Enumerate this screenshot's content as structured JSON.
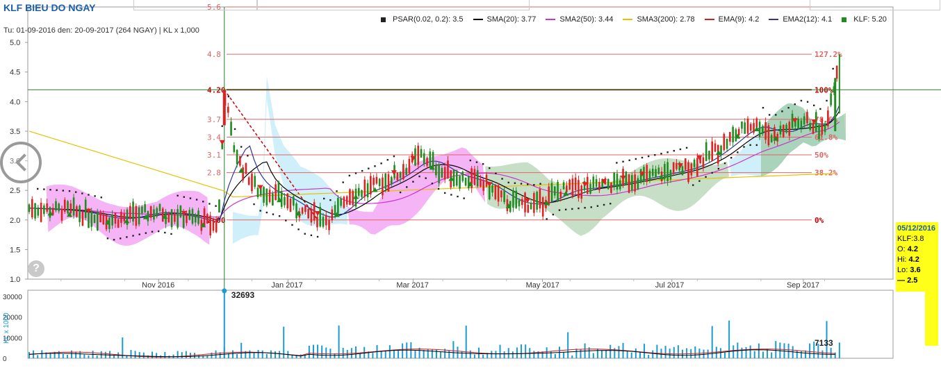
{
  "title": "KLF BIEU DO NGAY",
  "subtitle": "Tu: 01-09-2016 den: 20-09-2017 (264 NGAY) | KL x 1,000",
  "legend": [
    {
      "label": "PSAR(0.02, 0.2): 3.5",
      "color": "#222222",
      "kind": "square"
    },
    {
      "label": "SMA(20): 3.77",
      "color": "#000000",
      "kind": "line"
    },
    {
      "label": "SMA2(50): 3.44",
      "color": "#cc33cc",
      "kind": "line"
    },
    {
      "label": "SMA3(200): 2.78",
      "color": "#e6c200",
      "kind": "line"
    },
    {
      "label": "EMA(9): 4.2",
      "color": "#cc2222",
      "kind": "line"
    },
    {
      "label": "EMA2(12): 4.1",
      "color": "#333399",
      "kind": "line"
    },
    {
      "label": "KLF: 5.20",
      "color": "#1e8c1e",
      "kind": "square"
    }
  ],
  "colors": {
    "up": "#1e8c1e",
    "down": "#dd2222",
    "volume": "#1a9bd1",
    "fib": "#dd6666",
    "cloud_blue": "#a8e4f5",
    "cloud_pink": "#f29bf2",
    "cloud_green": "#8fbf8f"
  },
  "chart_data": {
    "type": "candlestick",
    "ylim": [
      1.0,
      5.6
    ],
    "yticks": [
      "1.0",
      "1.5",
      "2.0",
      "2.5",
      "3.0",
      "3.5",
      "4.0",
      "4.5",
      "5.0"
    ],
    "xtick_labels": [
      {
        "label": "Nov 2016",
        "day": 61
      },
      {
        "label": "Jan 2017",
        "day": 122
      },
      {
        "label": "Mar 2017",
        "day": 181
      },
      {
        "label": "May 2017",
        "day": 242
      },
      {
        "label": "Jul 2017",
        "day": 303
      },
      {
        "label": "Sep 2017",
        "day": 365
      }
    ],
    "fib_levels": [
      {
        "price": 5.6,
        "left": "5.6",
        "right": ""
      },
      {
        "price": 4.8,
        "left": "4.8",
        "right": "127.2%"
      },
      {
        "price": 4.2,
        "left": "4.20",
        "right": "100%"
      },
      {
        "price": 3.7,
        "left": "3.7",
        "right": "78.6%"
      },
      {
        "price": 3.4,
        "left": "3.4",
        "right": "61.8%"
      },
      {
        "price": 3.1,
        "left": "3.1",
        "right": "50%"
      },
      {
        "price": 2.8,
        "left": "2.8",
        "right": "38.2%"
      },
      {
        "price": 2.0,
        "left": "2.00",
        "right": "0%"
      }
    ],
    "hline": 4.2,
    "crosshair_day": 92,
    "price_points": [
      {
        "day": 0,
        "p": 2.2
      },
      {
        "day": 20,
        "p": 2.15
      },
      {
        "day": 40,
        "p": 2.0
      },
      {
        "day": 60,
        "p": 2.15
      },
      {
        "day": 80,
        "p": 2.0
      },
      {
        "day": 88,
        "p": 1.9
      },
      {
        "day": 90,
        "p": 2.3
      },
      {
        "day": 92,
        "p": 4.2
      },
      {
        "day": 96,
        "p": 3.3
      },
      {
        "day": 100,
        "p": 2.9
      },
      {
        "day": 108,
        "p": 2.5
      },
      {
        "day": 118,
        "p": 2.4
      },
      {
        "day": 130,
        "p": 2.1
      },
      {
        "day": 142,
        "p": 2.0
      },
      {
        "day": 150,
        "p": 2.4
      },
      {
        "day": 165,
        "p": 2.6
      },
      {
        "day": 175,
        "p": 2.8
      },
      {
        "day": 185,
        "p": 3.1
      },
      {
        "day": 195,
        "p": 2.8
      },
      {
        "day": 215,
        "p": 2.6
      },
      {
        "day": 225,
        "p": 2.3
      },
      {
        "day": 240,
        "p": 2.25
      },
      {
        "day": 250,
        "p": 2.5
      },
      {
        "day": 265,
        "p": 2.55
      },
      {
        "day": 280,
        "p": 2.65
      },
      {
        "day": 300,
        "p": 2.8
      },
      {
        "day": 312,
        "p": 2.9
      },
      {
        "day": 325,
        "p": 3.2
      },
      {
        "day": 338,
        "p": 3.6
      },
      {
        "day": 345,
        "p": 3.6
      },
      {
        "day": 350,
        "p": 3.4
      },
      {
        "day": 365,
        "p": 3.7
      },
      {
        "day": 375,
        "p": 3.5
      },
      {
        "day": 380,
        "p": 4.4
      },
      {
        "day": 382,
        "p": 4.8
      }
    ],
    "volume": {
      "ylim": [
        0,
        33000
      ],
      "yticks": [
        "0",
        "10000",
        "20000",
        "30000"
      ],
      "ylabel": "KL x 1000",
      "spike": {
        "day": 92,
        "value": 32693,
        "label": "32693"
      },
      "last": {
        "value": 7133,
        "label": "7133"
      }
    }
  },
  "tooltip": {
    "date": "05/12/2016",
    "name": "KLF:3.8",
    "open_label": "O:",
    "open": "4.2",
    "high_label": "Hi:",
    "high": "4.2",
    "low_label": "Lo:",
    "low": "3.6",
    "vol": "2.5"
  }
}
